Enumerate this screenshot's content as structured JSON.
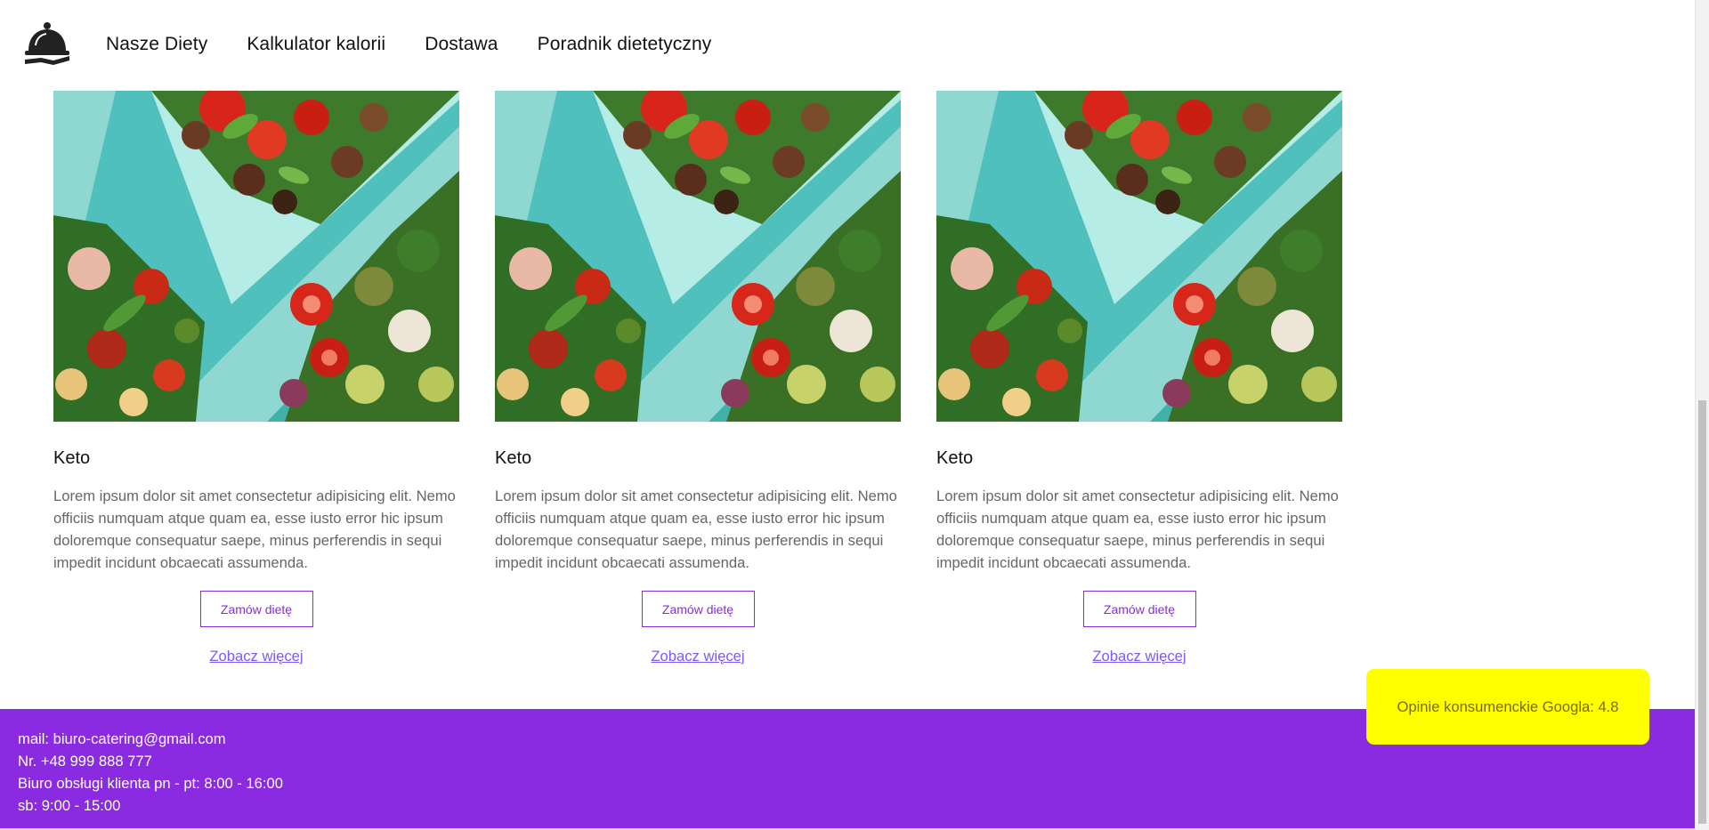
{
  "nav": {
    "logo_icon": "serving-cloche-icon",
    "links": [
      {
        "label": "Nasze Diety"
      },
      {
        "label": "Kalkulator kalorii"
      },
      {
        "label": "Dostawa"
      },
      {
        "label": "Poradnik dietetyczny"
      }
    ]
  },
  "cards": [
    {
      "title": "Keto",
      "text": "Lorem ipsum dolor sit amet consectetur adipisicing elit. Nemo officiis numquam atque quam ea, esse iusto error hic ipsum doloremque consequatur saepe, minus perferendis in sequi impedit incidunt obcaecati assumenda.",
      "button_label": "Zamów dietę",
      "link_label": "Zobacz więcej"
    },
    {
      "title": "Keto",
      "text": "Lorem ipsum dolor sit amet consectetur adipisicing elit. Nemo officiis numquam atque quam ea, esse iusto error hic ipsum doloremque consequatur saepe, minus perferendis in sequi impedit incidunt obcaecati assumenda.",
      "button_label": "Zamów dietę",
      "link_label": "Zobacz więcej"
    },
    {
      "title": "Keto",
      "text": "Lorem ipsum dolor sit amet consectetur adipisicing elit. Nemo officiis numquam atque quam ea, esse iusto error hic ipsum doloremque consequatur saepe, minus perferendis in sequi impedit incidunt obcaecati assumenda.",
      "button_label": "Zamów dietę",
      "link_label": "Zobacz więcej"
    }
  ],
  "footer": {
    "lines": [
      "mail: biuro-catering@gmail.com",
      "Nr. +48 999 888 777",
      "Biuro obsługi klienta pn - pt: 8:00 - 16:00",
      "sb: 9:00 - 15:00"
    ]
  },
  "rating": {
    "text": "Opinie konsumenckie Googla: 4.8"
  },
  "colors": {
    "accent": "#8a2be2",
    "rating_bg": "#ffff00",
    "link": "#7a5af8"
  }
}
